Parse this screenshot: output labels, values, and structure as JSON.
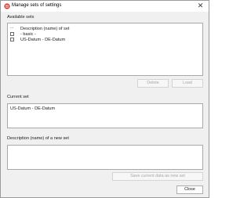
{
  "window": {
    "title": "Manage sets of settings",
    "close_glyph": "✕"
  },
  "available_sets": {
    "label": "Available sets",
    "header": "Description (name) of set",
    "header_marker": "...",
    "items": [
      {
        "label": "- basic -",
        "checked": false
      },
      {
        "label": "US-Datum - DE-Datum",
        "checked": false
      }
    ],
    "delete_label": "Delete",
    "load_label": "Load"
  },
  "current_set": {
    "label": "Current set",
    "value": "US-Datum - DE-Datum"
  },
  "new_set": {
    "label": "Description (name) of a new set",
    "value": "",
    "save_label": "Save current data as new set"
  },
  "footer": {
    "close_label": "Close"
  },
  "colors": {
    "app_icon_red": "#d9342b",
    "focus_blue": "#0067c0"
  }
}
